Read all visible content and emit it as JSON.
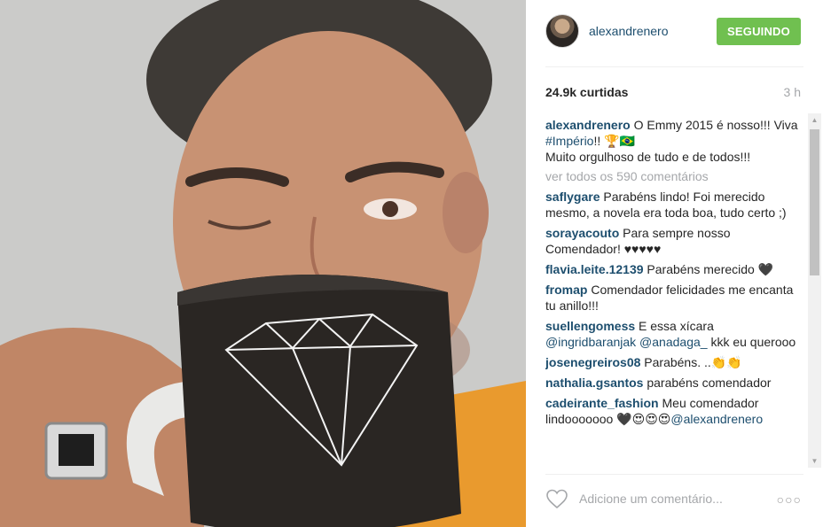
{
  "post": {
    "username": "alexandrenero",
    "follow_label": "SEGUINDO",
    "likes": "24.9k curtidas",
    "time": "3 h",
    "caption_user": "alexandrenero",
    "caption_text_1": " O Emmy 2015 é nosso!!! Viva ",
    "caption_tag": "#Império",
    "caption_text_2": "!! 🏆🇧🇷",
    "caption_line_2": "Muito orgulhoso de tudo e de todos!!!",
    "view_all": "ver todos os 590 comentários"
  },
  "comments": [
    {
      "user": "saflygare",
      "text": " Parabéns lindo! Foi merecido mesmo, a novela era toda boa, tudo certo ;)"
    },
    {
      "user": "sorayacouto",
      "text": " Para sempre nosso Comendador! ♥♥♥♥♥"
    },
    {
      "user": "flavia.leite.12139",
      "text": " Parabéns merecido 🖤"
    },
    {
      "user": "fromap",
      "text": " Comendador felicidades me encanta tu anillo!!!"
    },
    {
      "user": "suellengomess",
      "text": " E essa xícara",
      "mention_1": "@ingridbaranjak",
      "mention_2": "@anadaga_",
      "text_2": " kkk eu querooo"
    },
    {
      "user": "josenegreiros08",
      "text": " Parabéns. ..👏👏"
    },
    {
      "user": "nathalia.gsantos",
      "text": " parabéns comendador"
    },
    {
      "user": "cadeirante_fashion",
      "text": " Meu comendador lindooooooo 🖤😍😍😍",
      "mention_1": "@alexandrenero"
    }
  ],
  "footer": {
    "add_comment_placeholder": "Adicione um comentário...",
    "more_label": "○○○"
  },
  "scrollbar": {
    "up": "▲",
    "down": "▼"
  },
  "icons": {
    "like": "heart-icon",
    "options": "more-options-icon"
  },
  "colors": {
    "follow_button": "#70c050",
    "username": "#1d4e6e",
    "muted": "#a5a7aa"
  }
}
